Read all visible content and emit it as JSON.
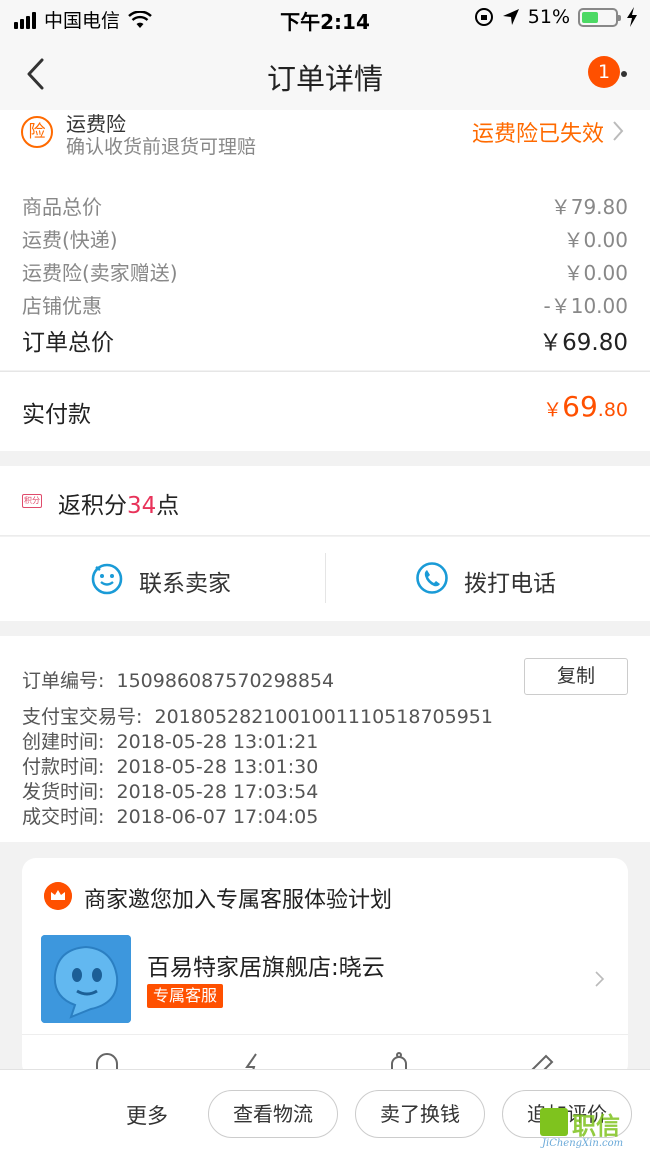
{
  "status_bar": {
    "carrier": "中国电信",
    "time": "下午2:14",
    "battery": "51%"
  },
  "nav": {
    "title": "订单详情",
    "badge": "1"
  },
  "insurance": {
    "icon_text": "险",
    "title": "运费险",
    "subtitle": "确认收货前退货可理赔",
    "status": "运费险已失效"
  },
  "prices": {
    "rows": [
      {
        "label": "商品总价",
        "value": "￥79.80"
      },
      {
        "label": "运费(快递)",
        "value": "￥0.00"
      },
      {
        "label": "运费险(卖家赠送)",
        "value": "￥0.00"
      },
      {
        "label": "店铺优惠",
        "value": "-￥10.00"
      }
    ],
    "total_label": "订单总价",
    "total_value": "￥69.80"
  },
  "paid": {
    "label": "实付款",
    "currency": "￥",
    "integer": "69",
    "decimal": ".80"
  },
  "points": {
    "icon_text": "积分",
    "prefix": "返积分",
    "value": "34",
    "suffix": "点"
  },
  "contact": {
    "seller_label": "联系卖家",
    "phone_label": "拨打电话"
  },
  "order_info": {
    "order_no_label": "订单编号:",
    "order_no": "150986087570298854",
    "copy_label": "复制",
    "alipay_label": "支付宝交易号:",
    "alipay_no": "2018052821001001110518705951",
    "created_label": "创建时间:",
    "created": "2018-05-28 13:01:21",
    "paid_label": "付款时间:",
    "paid": "2018-05-28 13:01:30",
    "shipped_label": "发货时间:",
    "shipped": "2018-05-28 17:03:54",
    "completed_label": "成交时间:",
    "completed": "2018-06-07 17:04:05"
  },
  "service": {
    "title": "商家邀您加入专属客服体验计划",
    "name": "百易特家居旗舰店:晓云",
    "tag": "专属客服"
  },
  "bottom": {
    "more": "更多",
    "logistics": "查看物流",
    "sell_cash": "卖了换钱",
    "review": "追加评价"
  },
  "watermark": {
    "text": "职信",
    "url": "JiChengXin.com"
  },
  "colors": {
    "accent": "#ff5000",
    "points": "#e8335a",
    "battery": "#4cd964",
    "contact_icon": "#1a9bd7"
  },
  "icons": [
    "back-icon",
    "more-icon",
    "wifi-icon",
    "location-icon",
    "charging-icon",
    "chevron-right-icon",
    "smile-icon",
    "phone-icon",
    "crown-icon"
  ]
}
